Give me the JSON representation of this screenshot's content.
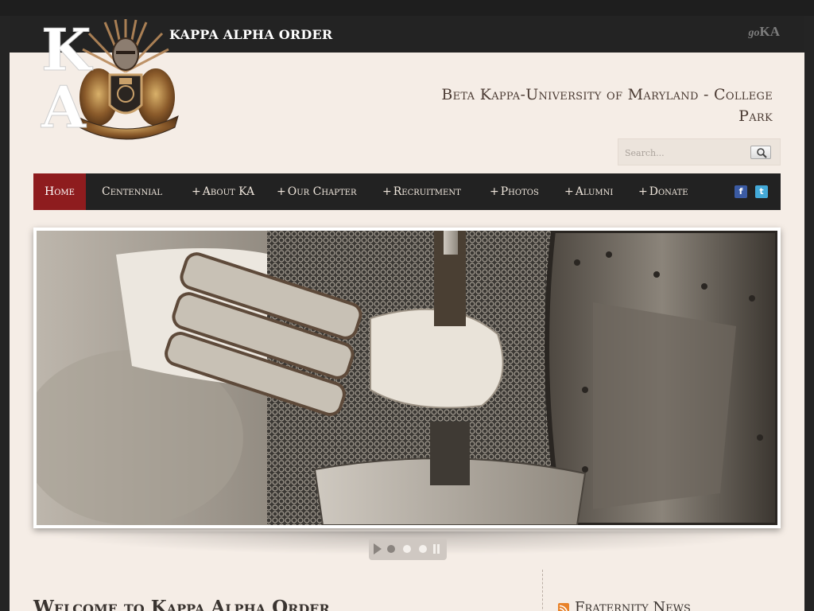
{
  "site": {
    "name": "KAPPA ALPHA ORDER",
    "goka_prefix": "go",
    "goka_suffix": "KA",
    "chapter_title": "Beta Kappa-University of Maryland - College Park",
    "logo_letters": "KA"
  },
  "search": {
    "placeholder": "Search..."
  },
  "nav": {
    "items": [
      {
        "label": "Home",
        "plus": ""
      },
      {
        "label": "Centennial",
        "plus": ""
      },
      {
        "label": "About KA",
        "plus": "+"
      },
      {
        "label": "Our Chapter",
        "plus": "+"
      },
      {
        "label": "Recruitment",
        "plus": "+"
      },
      {
        "label": "Photos",
        "plus": "+"
      },
      {
        "label": "Alumni",
        "plus": "+"
      },
      {
        "label": "Donate",
        "plus": "+"
      }
    ],
    "social": {
      "facebook": "f",
      "twitter": "t"
    }
  },
  "content": {
    "welcome_heading": "Welcome to Kappa Alpha Order",
    "sidebar_heading": "Fraternity News"
  },
  "colors": {
    "active_nav": "#8e1c1e",
    "nav_bg": "#222222",
    "page_bg": "#f5ede6"
  }
}
